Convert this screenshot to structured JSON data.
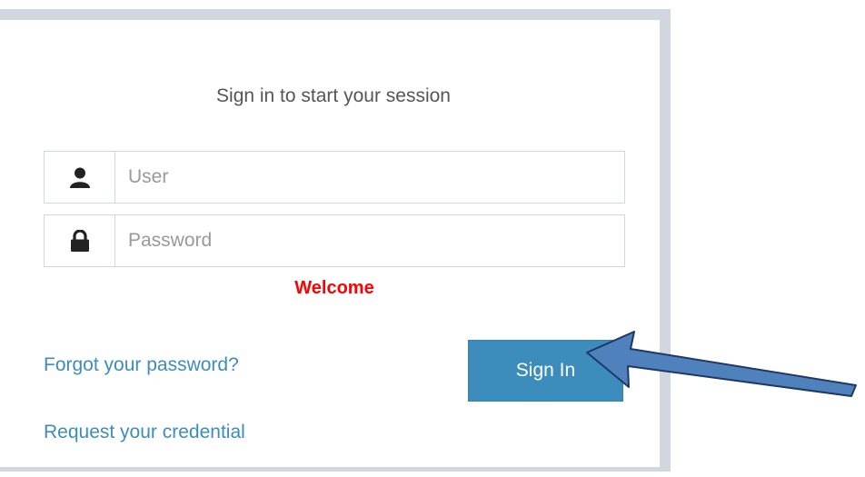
{
  "login": {
    "message": "Sign in to start your session",
    "user_placeholder": "User",
    "password_placeholder": "Password",
    "status_message": "Welcome",
    "forgot_link": "Forgot your password?",
    "request_link": "Request your credential",
    "signin_label": "Sign In"
  },
  "icons": {
    "user": "user-icon",
    "password": "lock-icon",
    "annotation": "arrow-icon"
  },
  "colors": {
    "accent": "#3c8dbc",
    "status": "#ff0000",
    "arrow_fill": "#4f81bd",
    "arrow_stroke": "#1f3864"
  }
}
